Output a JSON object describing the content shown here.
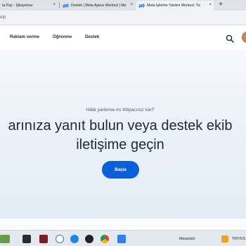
{
  "browser": {
    "tabs": [
      {
        "title": "ta Pay - Şikayetvar",
        "active": false
      },
      {
        "title": "Destek | Meta Ajansı Merkezi | Me",
        "active": false
      },
      {
        "title": "Meta İşletme Yardım Merkezi: Ya",
        "active": true
      }
    ],
    "new_tab_label": "+",
    "close_glyph": "×",
    "address_text": "elp"
  },
  "header": {
    "nav": [
      {
        "label": "Reklam verme"
      },
      {
        "label": "Öğrenme"
      },
      {
        "label": "Destek"
      }
    ],
    "search_icon": "search-icon"
  },
  "hero": {
    "eyebrow": "Hâlâ yardıma mı ihtiyacınız var?",
    "headline_line1": "arınıza yanıt bulun veya destek ekib",
    "headline_line2": "iletişime geçin",
    "cta_label": "Başla"
  },
  "taskbar": {
    "desktop_label": "Masaüstü",
    "tray_text": "TRY/US"
  },
  "colors": {
    "accent": "#0a60d8",
    "headline": "#1c2b33",
    "tabstrip": "#dfe3e8"
  }
}
